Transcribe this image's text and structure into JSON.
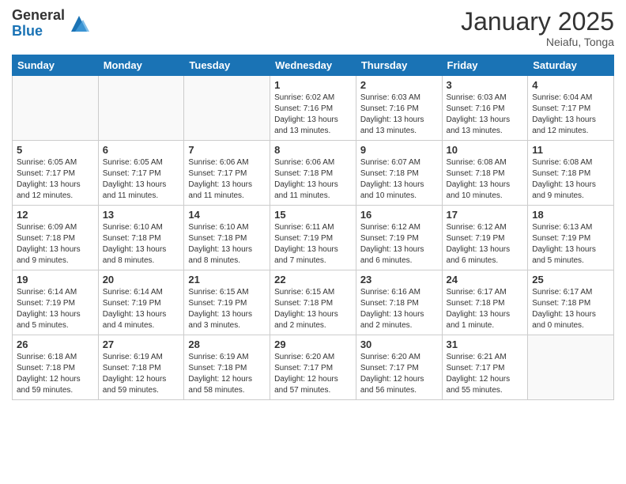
{
  "header": {
    "logo_general": "General",
    "logo_blue": "Blue",
    "month_title": "January 2025",
    "subtitle": "Neiafu, Tonga"
  },
  "days_of_week": [
    "Sunday",
    "Monday",
    "Tuesday",
    "Wednesday",
    "Thursday",
    "Friday",
    "Saturday"
  ],
  "weeks": [
    [
      {
        "day": "",
        "info": ""
      },
      {
        "day": "",
        "info": ""
      },
      {
        "day": "",
        "info": ""
      },
      {
        "day": "1",
        "info": "Sunrise: 6:02 AM\nSunset: 7:16 PM\nDaylight: 13 hours\nand 13 minutes."
      },
      {
        "day": "2",
        "info": "Sunrise: 6:03 AM\nSunset: 7:16 PM\nDaylight: 13 hours\nand 13 minutes."
      },
      {
        "day": "3",
        "info": "Sunrise: 6:03 AM\nSunset: 7:16 PM\nDaylight: 13 hours\nand 13 minutes."
      },
      {
        "day": "4",
        "info": "Sunrise: 6:04 AM\nSunset: 7:17 PM\nDaylight: 13 hours\nand 12 minutes."
      }
    ],
    [
      {
        "day": "5",
        "info": "Sunrise: 6:05 AM\nSunset: 7:17 PM\nDaylight: 13 hours\nand 12 minutes."
      },
      {
        "day": "6",
        "info": "Sunrise: 6:05 AM\nSunset: 7:17 PM\nDaylight: 13 hours\nand 11 minutes."
      },
      {
        "day": "7",
        "info": "Sunrise: 6:06 AM\nSunset: 7:17 PM\nDaylight: 13 hours\nand 11 minutes."
      },
      {
        "day": "8",
        "info": "Sunrise: 6:06 AM\nSunset: 7:18 PM\nDaylight: 13 hours\nand 11 minutes."
      },
      {
        "day": "9",
        "info": "Sunrise: 6:07 AM\nSunset: 7:18 PM\nDaylight: 13 hours\nand 10 minutes."
      },
      {
        "day": "10",
        "info": "Sunrise: 6:08 AM\nSunset: 7:18 PM\nDaylight: 13 hours\nand 10 minutes."
      },
      {
        "day": "11",
        "info": "Sunrise: 6:08 AM\nSunset: 7:18 PM\nDaylight: 13 hours\nand 9 minutes."
      }
    ],
    [
      {
        "day": "12",
        "info": "Sunrise: 6:09 AM\nSunset: 7:18 PM\nDaylight: 13 hours\nand 9 minutes."
      },
      {
        "day": "13",
        "info": "Sunrise: 6:10 AM\nSunset: 7:18 PM\nDaylight: 13 hours\nand 8 minutes."
      },
      {
        "day": "14",
        "info": "Sunrise: 6:10 AM\nSunset: 7:18 PM\nDaylight: 13 hours\nand 8 minutes."
      },
      {
        "day": "15",
        "info": "Sunrise: 6:11 AM\nSunset: 7:19 PM\nDaylight: 13 hours\nand 7 minutes."
      },
      {
        "day": "16",
        "info": "Sunrise: 6:12 AM\nSunset: 7:19 PM\nDaylight: 13 hours\nand 6 minutes."
      },
      {
        "day": "17",
        "info": "Sunrise: 6:12 AM\nSunset: 7:19 PM\nDaylight: 13 hours\nand 6 minutes."
      },
      {
        "day": "18",
        "info": "Sunrise: 6:13 AM\nSunset: 7:19 PM\nDaylight: 13 hours\nand 5 minutes."
      }
    ],
    [
      {
        "day": "19",
        "info": "Sunrise: 6:14 AM\nSunset: 7:19 PM\nDaylight: 13 hours\nand 5 minutes."
      },
      {
        "day": "20",
        "info": "Sunrise: 6:14 AM\nSunset: 7:19 PM\nDaylight: 13 hours\nand 4 minutes."
      },
      {
        "day": "21",
        "info": "Sunrise: 6:15 AM\nSunset: 7:19 PM\nDaylight: 13 hours\nand 3 minutes."
      },
      {
        "day": "22",
        "info": "Sunrise: 6:15 AM\nSunset: 7:18 PM\nDaylight: 13 hours\nand 2 minutes."
      },
      {
        "day": "23",
        "info": "Sunrise: 6:16 AM\nSunset: 7:18 PM\nDaylight: 13 hours\nand 2 minutes."
      },
      {
        "day": "24",
        "info": "Sunrise: 6:17 AM\nSunset: 7:18 PM\nDaylight: 13 hours\nand 1 minute."
      },
      {
        "day": "25",
        "info": "Sunrise: 6:17 AM\nSunset: 7:18 PM\nDaylight: 13 hours\nand 0 minutes."
      }
    ],
    [
      {
        "day": "26",
        "info": "Sunrise: 6:18 AM\nSunset: 7:18 PM\nDaylight: 12 hours\nand 59 minutes."
      },
      {
        "day": "27",
        "info": "Sunrise: 6:19 AM\nSunset: 7:18 PM\nDaylight: 12 hours\nand 59 minutes."
      },
      {
        "day": "28",
        "info": "Sunrise: 6:19 AM\nSunset: 7:18 PM\nDaylight: 12 hours\nand 58 minutes."
      },
      {
        "day": "29",
        "info": "Sunrise: 6:20 AM\nSunset: 7:17 PM\nDaylight: 12 hours\nand 57 minutes."
      },
      {
        "day": "30",
        "info": "Sunrise: 6:20 AM\nSunset: 7:17 PM\nDaylight: 12 hours\nand 56 minutes."
      },
      {
        "day": "31",
        "info": "Sunrise: 6:21 AM\nSunset: 7:17 PM\nDaylight: 12 hours\nand 55 minutes."
      },
      {
        "day": "",
        "info": ""
      }
    ]
  ]
}
